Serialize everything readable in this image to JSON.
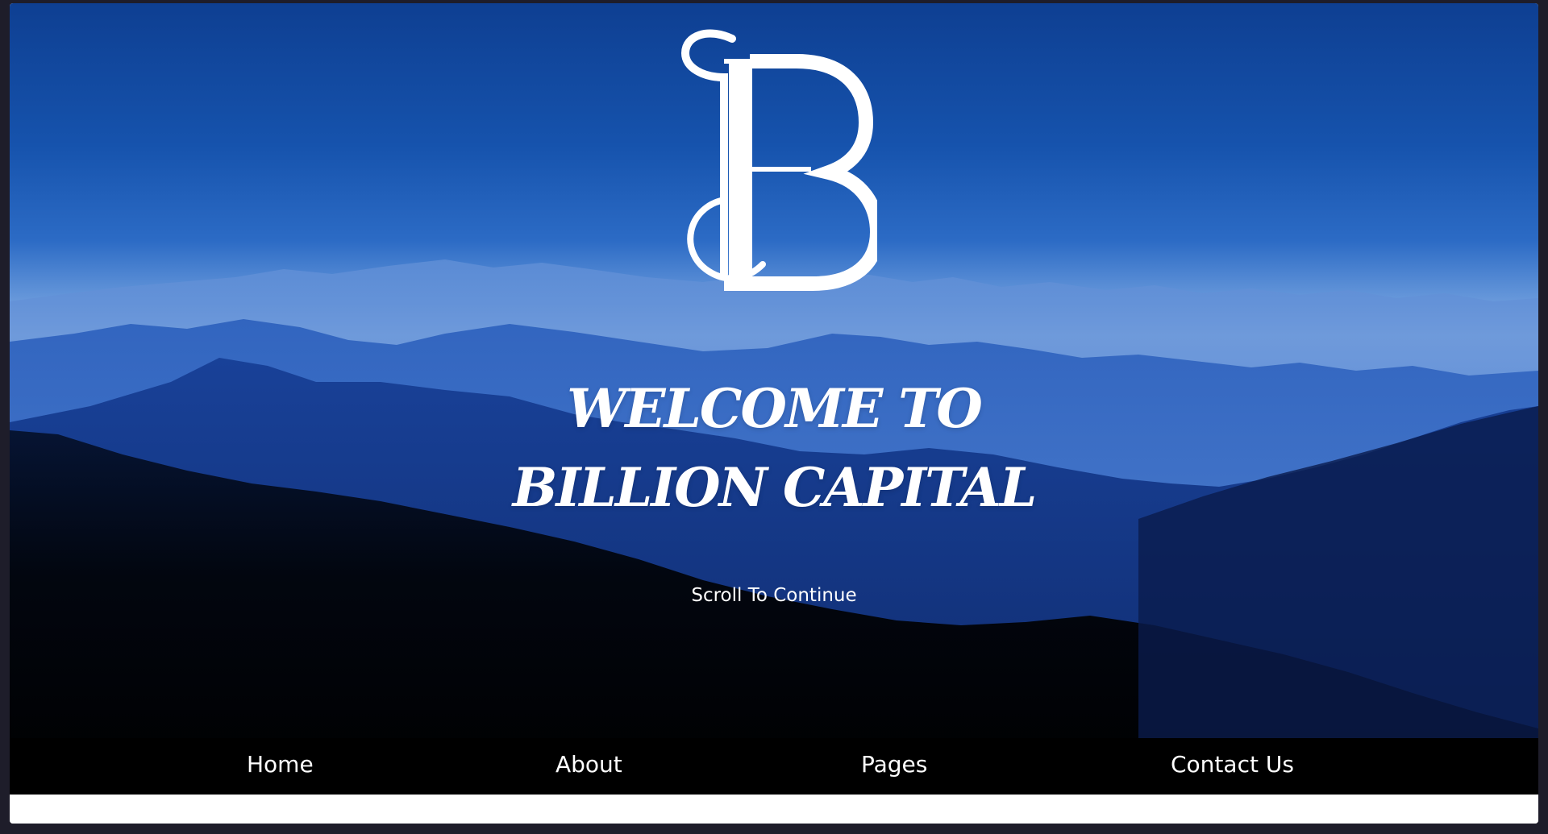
{
  "hero": {
    "background": "mountain-range-blue",
    "logo": {
      "letters": "BL",
      "icon": "billion-capital-monogram-logo",
      "color": "#ffffff"
    },
    "welcome_line1": "WELCOME TO",
    "welcome_line2": "BILLION CAPITAL",
    "scroll_text": "Scroll To Continue"
  },
  "nav": {
    "items": [
      {
        "label": "Home"
      },
      {
        "label": "About"
      },
      {
        "label": "Pages"
      },
      {
        "label": "Contact Us"
      }
    ]
  },
  "colors": {
    "sky_top": "#0e3f92",
    "mist": "#9fbfe9",
    "nav_bg": "#000000",
    "text": "#ffffff",
    "window_bg": "#1e1d2a"
  }
}
